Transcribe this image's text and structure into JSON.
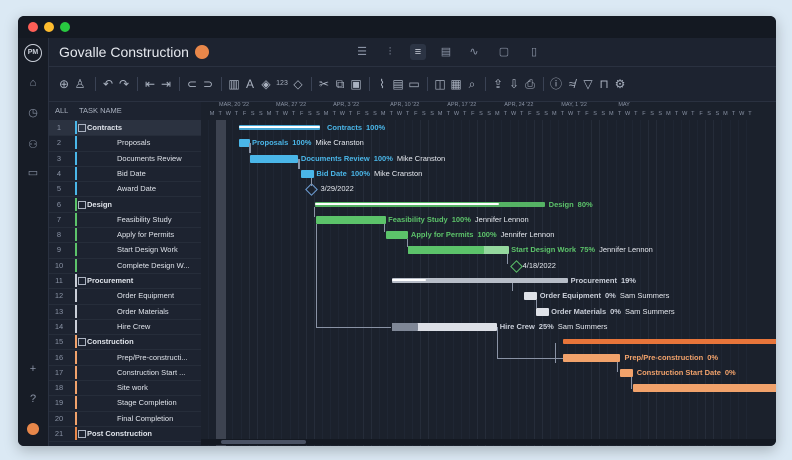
{
  "app": {
    "title": "Govalle Construction",
    "logo": "PM"
  },
  "colors": {
    "contracts": "#4ab6e8",
    "design": "#5cc36a",
    "procurement": "#c9ced8",
    "construction": "#f1a26b"
  },
  "nav_icons": [
    "home-icon",
    "clock-icon",
    "users-icon",
    "briefcase-icon",
    "plus-icon",
    "help-icon",
    "user-avatar"
  ],
  "view_icons": [
    "list-view-icon",
    "board-view-icon",
    "gantt-view-icon",
    "sheet-view-icon",
    "dashboard-view-icon",
    "calendar-view-icon",
    "file-view-icon"
  ],
  "toolbar_icons": [
    "add-task-icon",
    "add-user-icon",
    "undo-icon",
    "redo-icon",
    "outdent-icon",
    "indent-icon",
    "link-icon",
    "unlink-icon",
    "delete-icon",
    "text-color-icon",
    "fill-color-icon",
    "numbering-icon",
    "milestone-icon",
    "cut-icon",
    "copy-icon",
    "paste-icon",
    "attach-icon",
    "notes-icon",
    "comment-icon",
    "columns-icon",
    "table-icon",
    "zoom-icon",
    "export-icon",
    "import-icon",
    "print-icon",
    "info-icon",
    "baseline-icon",
    "filter-icon",
    "lock-icon",
    "settings-icon"
  ],
  "columns": {
    "all": "ALL",
    "task_name": "TASK NAME"
  },
  "weeks": [
    "MAR, 20 '22",
    "MAR, 27 '22",
    "APR, 3 '22",
    "APR, 10 '22",
    "APR, 17 '22",
    "APR, 24 '22",
    "MAY, 1 '22",
    "MAY"
  ],
  "days": [
    "M",
    "T",
    "W",
    "T",
    "F",
    "S",
    "S",
    "M",
    "T",
    "W",
    "T",
    "F",
    "S",
    "S",
    "M",
    "T",
    "W",
    "T",
    "F",
    "S",
    "S",
    "M",
    "T",
    "W",
    "T",
    "F",
    "S",
    "S",
    "M",
    "T",
    "W",
    "T",
    "F",
    "S",
    "S",
    "M",
    "T",
    "W",
    "T",
    "F",
    "S",
    "S",
    "M",
    "T",
    "W",
    "T",
    "F",
    "S",
    "S",
    "M",
    "T",
    "W",
    "T",
    "F",
    "S",
    "S",
    "M",
    "T",
    "W",
    "T",
    "F",
    "S",
    "S",
    "M",
    "T",
    "W",
    "T"
  ],
  "tasks": [
    {
      "num": "1",
      "name": "Contracts",
      "group": "contracts",
      "summary": true
    },
    {
      "num": "2",
      "name": "Proposals",
      "group": "contracts"
    },
    {
      "num": "3",
      "name": "Documents Review",
      "group": "contracts"
    },
    {
      "num": "4",
      "name": "Bid Date",
      "group": "contracts"
    },
    {
      "num": "5",
      "name": "Award Date",
      "group": "contracts"
    },
    {
      "num": "6",
      "name": "Design",
      "group": "design",
      "summary": true
    },
    {
      "num": "7",
      "name": "Feasibility Study",
      "group": "design"
    },
    {
      "num": "8",
      "name": "Apply for Permits",
      "group": "design"
    },
    {
      "num": "9",
      "name": "Start Design Work",
      "group": "design"
    },
    {
      "num": "10",
      "name": "Complete Design W...",
      "group": "design"
    },
    {
      "num": "11",
      "name": "Procurement",
      "group": "procurement",
      "summary": true
    },
    {
      "num": "12",
      "name": "Order Equipment",
      "group": "procurement"
    },
    {
      "num": "13",
      "name": "Order Materials",
      "group": "procurement"
    },
    {
      "num": "14",
      "name": "Hire Crew",
      "group": "procurement"
    },
    {
      "num": "15",
      "name": "Construction",
      "group": "construction",
      "summary": true
    },
    {
      "num": "16",
      "name": "Prep/Pre-constructi...",
      "group": "construction"
    },
    {
      "num": "17",
      "name": "Construction Start ...",
      "group": "construction"
    },
    {
      "num": "18",
      "name": "Site work",
      "group": "construction"
    },
    {
      "num": "19",
      "name": "Stage Completion",
      "group": "construction"
    },
    {
      "num": "20",
      "name": "Final Completion",
      "group": "construction"
    },
    {
      "num": "21",
      "name": "Post Construction",
      "group": "post",
      "summary": true
    }
  ],
  "gantt_labels": [
    {
      "name": "Contracts",
      "pct": "100%",
      "who": ""
    },
    {
      "name": "Proposals",
      "pct": "100%",
      "who": "Mike Cranston"
    },
    {
      "name": "Documents Review",
      "pct": "100%",
      "who": "Mike Cranston"
    },
    {
      "name": "Bid Date",
      "pct": "100%",
      "who": "Mike Cranston"
    },
    {
      "name": "",
      "pct": "",
      "who": "3/29/2022"
    },
    {
      "name": "Design",
      "pct": "80%",
      "who": ""
    },
    {
      "name": "Feasibility Study",
      "pct": "100%",
      "who": "Jennifer Lennon"
    },
    {
      "name": "Apply for Permits",
      "pct": "100%",
      "who": "Jennifer Lennon"
    },
    {
      "name": "Start Design Work",
      "pct": "75%",
      "who": "Jennifer Lennon"
    },
    {
      "name": "",
      "pct": "",
      "who": "4/18/2022"
    },
    {
      "name": "Procurement",
      "pct": "19%",
      "who": ""
    },
    {
      "name": "Order Equipment",
      "pct": "0%",
      "who": "Sam Summers"
    },
    {
      "name": "Order Materials",
      "pct": "0%",
      "who": "Sam Summers"
    },
    {
      "name": "Hire Crew",
      "pct": "25%",
      "who": "Sam Summers"
    },
    {
      "name": "",
      "pct": "",
      "who": ""
    },
    {
      "name": "Prep/Pre-construction",
      "pct": "0%",
      "who": ""
    },
    {
      "name": "Construction Start Date",
      "pct": "0%",
      "who": ""
    }
  ]
}
